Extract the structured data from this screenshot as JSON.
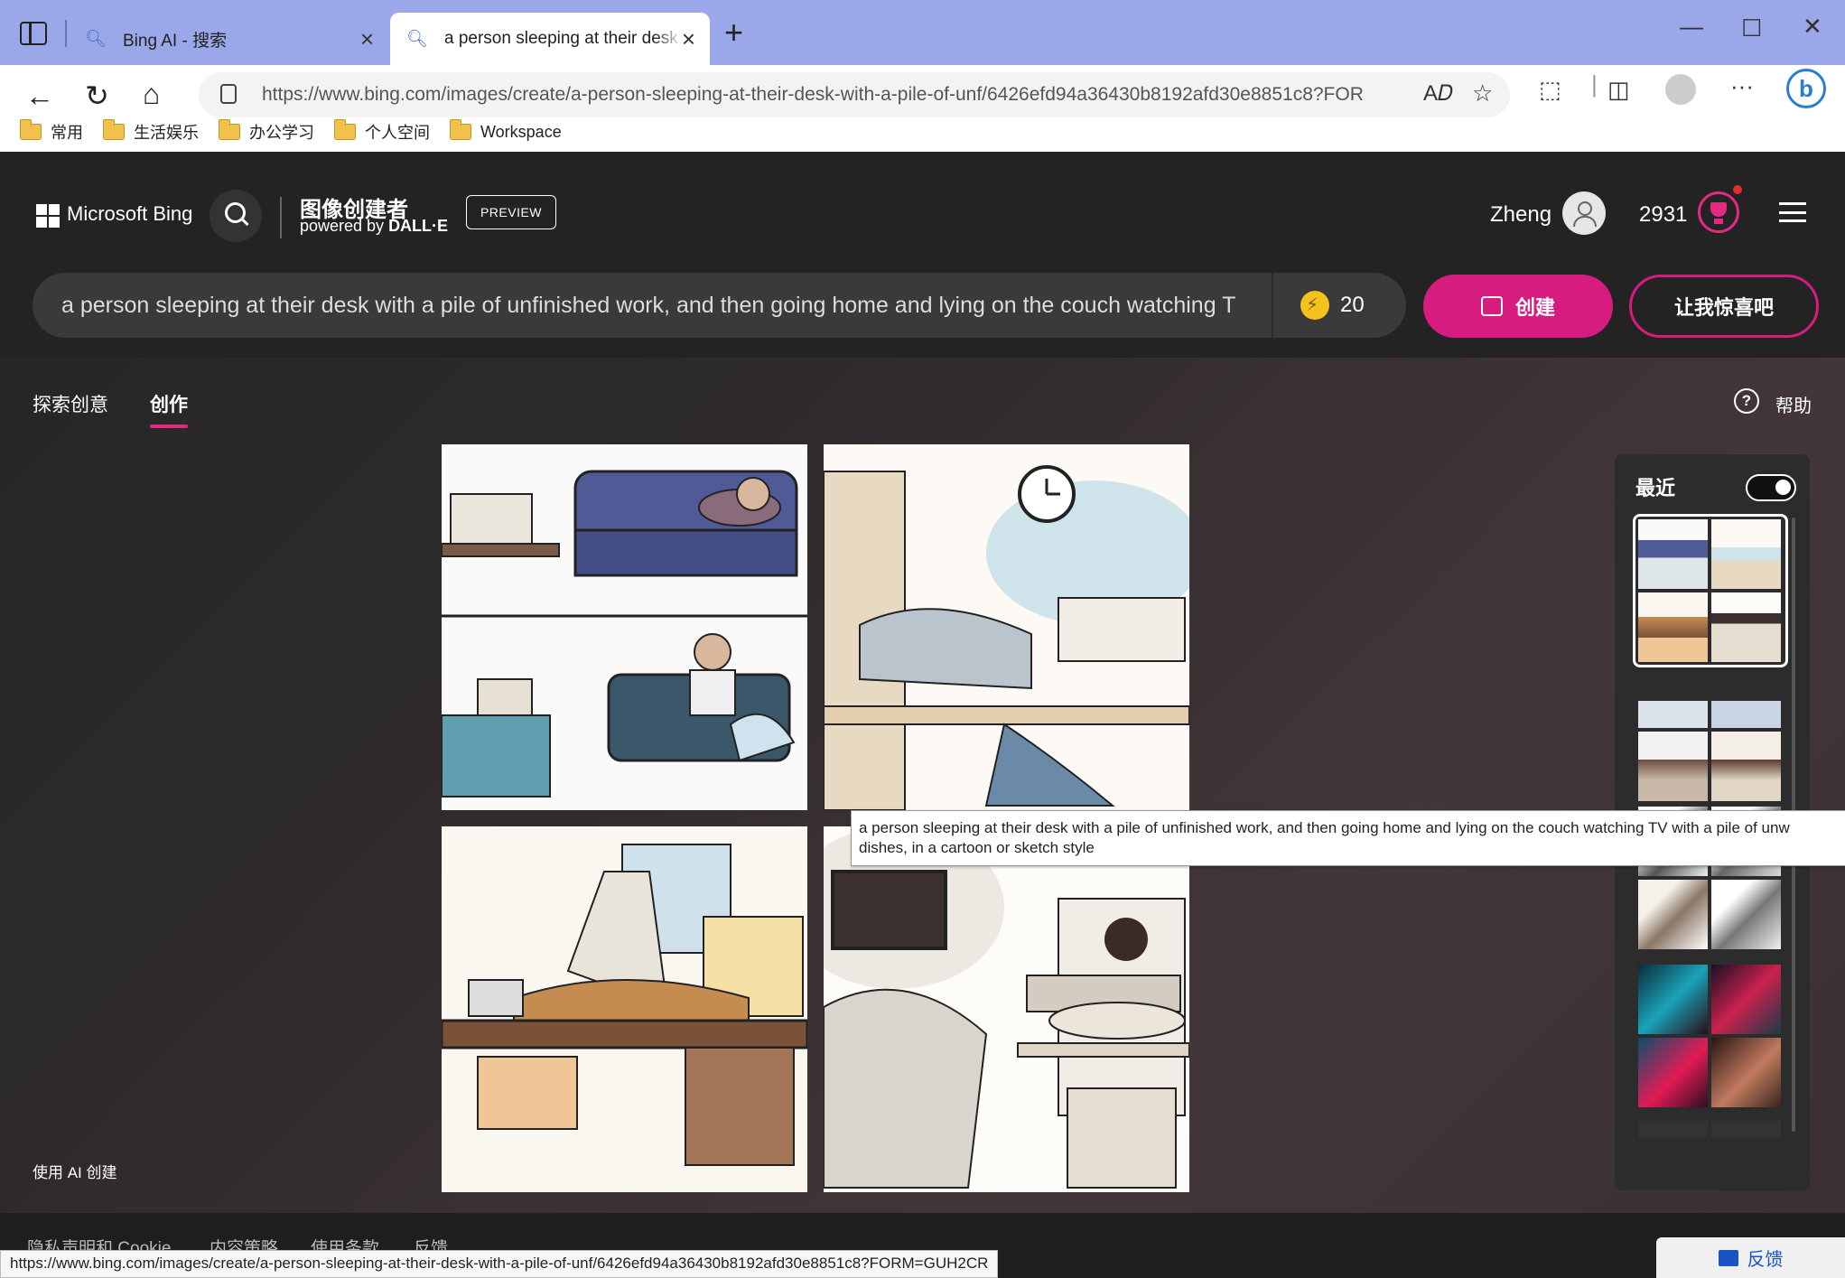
{
  "browser": {
    "tabs": [
      {
        "label": "Bing AI - 搜索",
        "icon": "search-icon"
      },
      {
        "label": "a person sleeping at their desk w",
        "icon": "search-icon"
      }
    ],
    "url": "https://www.bing.com/images/create/a-person-sleeping-at-their-desk-with-a-pile-of-unf/6426efd94a36430b8192afd30e8851c8?FORM...",
    "bookmarks": [
      "常用",
      "生活娱乐",
      "办公学习",
      "个人空间",
      "Workspace"
    ],
    "status_url": "https://www.bing.com/images/create/a-person-sleeping-at-their-desk-with-a-pile-of-unf/6426efd94a36430b8192afd30e8851c8?FORM=GUH2CR"
  },
  "header": {
    "brand": "Microsoft Bing",
    "creator_title": "图像创建者",
    "powered_prefix": "powered by ",
    "powered_name": "DALL·E",
    "preview_badge": "PREVIEW",
    "username": "Zheng",
    "points": "2931"
  },
  "prompt": {
    "text": "a person sleeping at their desk with a pile of unfinished work, and then going home and lying on the couch watching TV with a pile of unwashed dishes, in a cartoon or sketch style",
    "boosts": "20",
    "create_label": "创建",
    "surprise_label": "让我惊喜吧"
  },
  "nav": {
    "explore": "探索创意",
    "create": "创作",
    "help": "帮助"
  },
  "recent": {
    "title": "最近",
    "toggle_on": true
  },
  "tooltip": {
    "line1": "a person sleeping at their desk with a pile of unfinished work, and then going home and lying on the couch watching TV with a pile of unw",
    "line2": "dishes, in a cartoon or sketch style"
  },
  "footer": {
    "made_with_ai": "使用 AI 创建",
    "links": [
      "隐私声明和 Cookie",
      "内容策略",
      "使用条款",
      "反馈"
    ],
    "feedback_button": "反馈"
  },
  "colors": {
    "accent": "#d61d7f",
    "tabbar": "#9aa7e9",
    "header_bg": "#232323"
  }
}
